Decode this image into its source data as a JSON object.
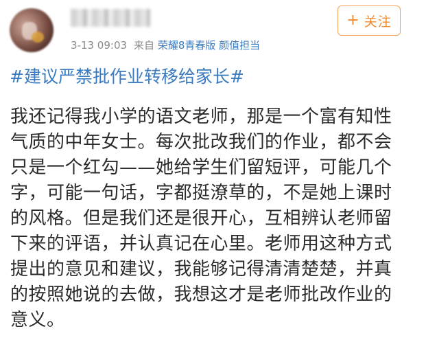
{
  "post": {
    "timestamp": "3-13 09:03",
    "source_prefix": "来自",
    "device": "荣耀8青春版 颜值担当",
    "follow_button": {
      "icon": "plus-icon",
      "label": "关注"
    },
    "hashtag": "#建议严禁批作业转移给家长#",
    "body_lines": [
      "我还记得我小学的语文老师，那是一个富有知性",
      "气质的中年女士。每次批改我们的作业，都不会",
      "只是一个红勾——她给学生们留短评，可能几个",
      "字，可能一句话，字都挺潦草的，不是她上课时",
      "的风格。但是我们还是很开心，互相辨认老师留",
      "下来的评语，并认真记在心里。老师用这种方式",
      "提出的意见和建议，我能够记得清清楚楚，并真",
      "的按照她说的去做，我想这才是老师批改作业的",
      "意义。"
    ]
  },
  "colors": {
    "link_blue": "#3b7bbf",
    "follow_orange": "#f08a2e",
    "meta_gray": "#8a8a8a",
    "text": "#2b2b2b"
  }
}
